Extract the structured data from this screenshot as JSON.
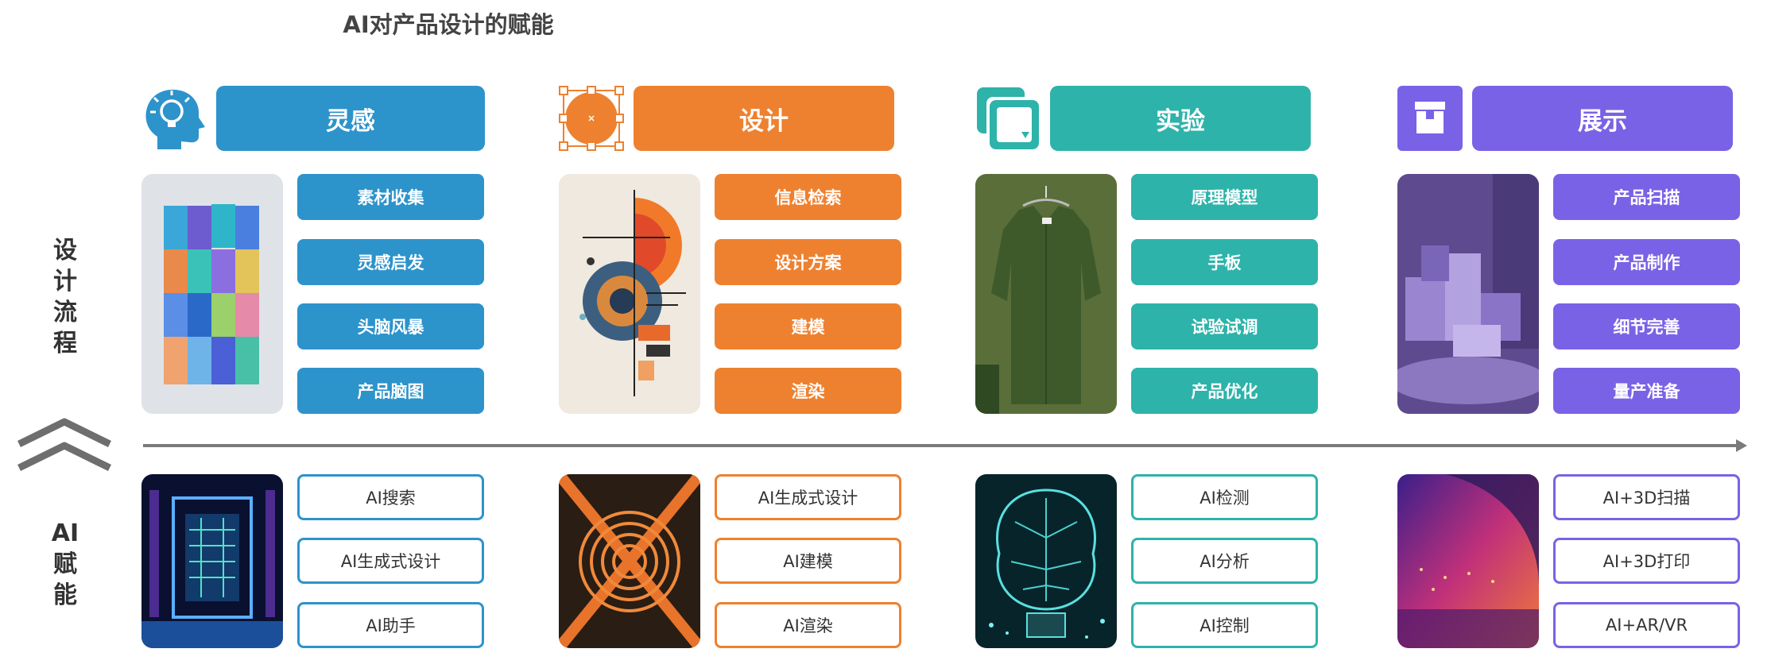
{
  "title": "AI对产品设计的赋能",
  "side_labels": {
    "process": [
      "设",
      "计",
      "流",
      "程"
    ],
    "ai": [
      "AI",
      "赋",
      "能"
    ]
  },
  "columns": [
    {
      "header": "灵感",
      "color": "#2D93CB",
      "icon": "head-lightbulb-icon",
      "steps": [
        "素材收集",
        "灵感启发",
        "头脑风暴",
        "产品脑图"
      ],
      "ai_tools": [
        "AI搜索",
        "AI生成式设计",
        "AI助手"
      ]
    },
    {
      "header": "设计",
      "color": "#EE812F",
      "icon": "vector-selection-icon",
      "steps": [
        "信息检索",
        "设计方案",
        "建模",
        "渲染"
      ],
      "ai_tools": [
        "AI生成式设计",
        "AI建模",
        "AI渲染"
      ]
    },
    {
      "header": "实验",
      "color": "#2DB3AA",
      "icon": "stacked-windows-icon",
      "steps": [
        "原理模型",
        "手板",
        "试验试调",
        "产品优化"
      ],
      "ai_tools": [
        "AI检测",
        "AI分析",
        "AI控制"
      ]
    },
    {
      "header": "展示",
      "color": "#7A62E6",
      "icon": "box-icon",
      "steps": [
        "产品扫描",
        "产品制作",
        "细节完善",
        "量产准备"
      ],
      "ai_tools": [
        "AI+3D扫描",
        "AI+3D打印",
        "AI+AR/VR"
      ]
    }
  ]
}
